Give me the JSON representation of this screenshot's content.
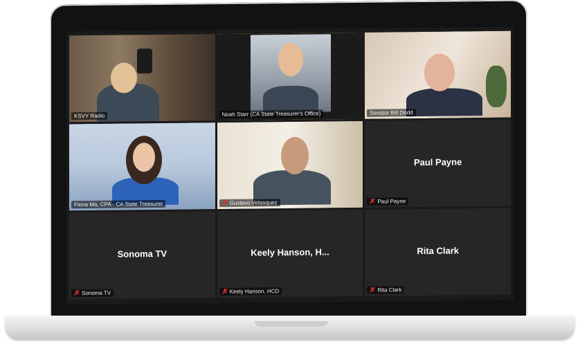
{
  "tiles": [
    {
      "name": "KSVY Radio",
      "muted": false,
      "video": true
    },
    {
      "name": "Noah Starr (CA State Treasurer's Office)",
      "muted": false,
      "video": true,
      "active": true
    },
    {
      "name": "Senator Bill Dodd",
      "muted": false,
      "video": true
    },
    {
      "name": "Fiona Ma, CPA - CA State Treasurer",
      "muted": false,
      "video": true
    },
    {
      "name": "Gustavo Velasquez",
      "muted": true,
      "video": true
    },
    {
      "name": "Paul Payne",
      "display": "Paul Payne",
      "muted": true,
      "video": false
    },
    {
      "name": "Sonoma TV",
      "display": "Sonoma TV",
      "muted": true,
      "video": false
    },
    {
      "name": "Keely Hanson, HCD",
      "display": "Keely  Hanson,  H...",
      "muted": true,
      "video": false
    },
    {
      "name": "Rita Clark",
      "display": "Rita Clark",
      "muted": true,
      "video": false
    }
  ],
  "colors": {
    "active_border": "#a9d64f",
    "mute_icon": "#e02f2f",
    "tile_bg": "#262626"
  }
}
